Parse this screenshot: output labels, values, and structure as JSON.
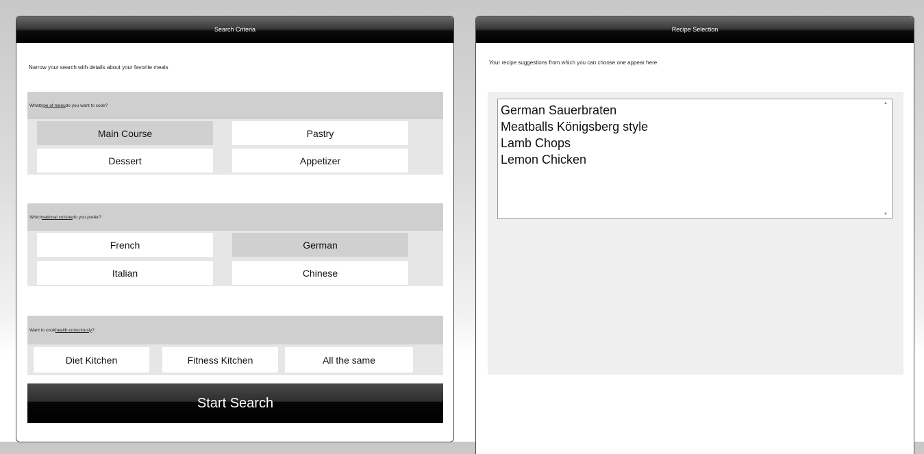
{
  "search_panel": {
    "title": "Search Criteria",
    "intro": "Narrow your search with details about your favorite meals",
    "menu_type": {
      "question_prefix": "What ",
      "question_link": "type of menu",
      "question_suffix": " do you want to cook?",
      "options": [
        "Main Course",
        "Pastry",
        "Dessert",
        "Appetizer"
      ],
      "selected": "Main Course"
    },
    "cuisine": {
      "question_prefix": "Which ",
      "question_link": "national cuisine",
      "question_suffix": " do you prefer?",
      "options": [
        "French",
        "German",
        "Italian",
        "Chinese"
      ],
      "selected": "German"
    },
    "health": {
      "question_prefix": "Want to cook ",
      "question_link": "health-consciously",
      "question_suffix": "?",
      "options": [
        "Diet Kitchen",
        "Fitness Kitchen",
        "All the same"
      ]
    },
    "start_button": "Start Search"
  },
  "recipe_panel": {
    "title": "Recipe Selection",
    "intro": "Your recipe suggestions from which you can choose one appear here",
    "recipes": [
      "German Sauerbraten",
      "Meatballs Königsberg style",
      "Lamb Chops",
      "Lemon Chicken"
    ]
  },
  "icons": {
    "scroll_up": "scroll-up-arrow-icon",
    "scroll_down": "scroll-down-arrow-icon"
  }
}
